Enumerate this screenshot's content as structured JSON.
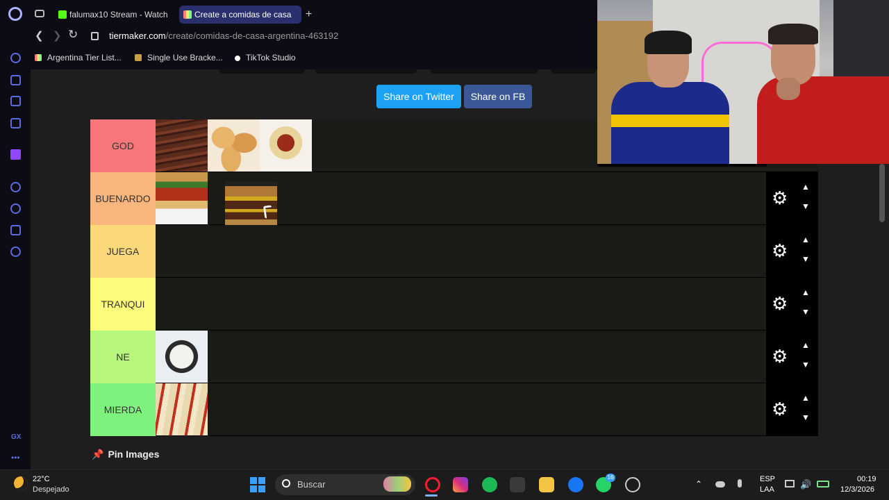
{
  "browser": {
    "tabs": [
      {
        "label": "falumax10 Stream - Watch"
      },
      {
        "label": "Create a comidas de casa"
      }
    ],
    "new_tab_label": "+",
    "url_domain": "tiermaker.com",
    "url_path": "/create/comidas-de-casa-argentina-463192",
    "bookmarks": [
      {
        "label": "Argentina Tier List..."
      },
      {
        "label": "Single Use Bracke..."
      },
      {
        "label": "TikTok Studio"
      }
    ],
    "sidebar_gx": "GX",
    "sidebar_more": "•••"
  },
  "page": {
    "share_twitter": "Share on Twitter",
    "share_fb": "Share on FB",
    "pin_images": "Pin Images",
    "tiers": [
      {
        "label": "GOD",
        "color": "#f7777a",
        "items": [
          "asado",
          "empanadas",
          "spaghetti"
        ]
      },
      {
        "label": "BUENARDO",
        "color": "#f9b57c",
        "items": [
          "choripan",
          "burger"
        ]
      },
      {
        "label": "JUEGA",
        "color": "#fbd97a",
        "items": []
      },
      {
        "label": "TRANQUI",
        "color": "#fdfd7d",
        "items": []
      },
      {
        "label": "NE",
        "color": "#b7f77d",
        "items": [
          "arroz"
        ]
      },
      {
        "label": "MIERDA",
        "color": "#7ff27e",
        "items": [
          "canelones"
        ]
      }
    ]
  },
  "taskbar": {
    "temperature": "22°C",
    "weather": "Despejado",
    "search_placeholder": "Buscar",
    "whatsapp_badge": "16",
    "lang_top": "ESP",
    "lang_bottom": "LAA",
    "time": "00:19",
    "date": "12/3/2026"
  }
}
